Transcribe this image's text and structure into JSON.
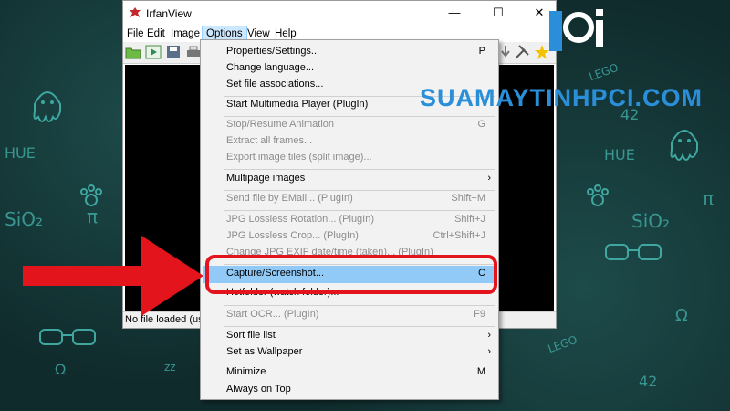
{
  "window": {
    "title": "IrfanView",
    "minimize_glyph": "—",
    "maximize_glyph": "☐",
    "close_glyph": "✕"
  },
  "menubar": {
    "items": [
      {
        "label": "File"
      },
      {
        "label": "Edit"
      },
      {
        "label": "Image"
      },
      {
        "label": "Options"
      },
      {
        "label": "View"
      },
      {
        "label": "Help"
      }
    ]
  },
  "status": {
    "text": "No file loaded (use"
  },
  "options_menu": {
    "items": [
      {
        "label": "Properties/Settings...",
        "shortcut": "P",
        "disabled": false
      },
      {
        "label": "Change language...",
        "shortcut": "",
        "disabled": false
      },
      {
        "label": "Set file associations...",
        "shortcut": "",
        "disabled": false
      },
      {
        "label": "Start Multimedia Player (PlugIn)",
        "shortcut": "",
        "disabled": false
      },
      {
        "label": "Stop/Resume Animation",
        "shortcut": "G",
        "disabled": true
      },
      {
        "label": "Extract all frames...",
        "shortcut": "",
        "disabled": true
      },
      {
        "label": "Export image tiles (split image)...",
        "shortcut": "",
        "disabled": true
      },
      {
        "label": "Multipage images",
        "shortcut": "",
        "disabled": false,
        "submenu": true
      },
      {
        "label": "Send file by EMail... (PlugIn)",
        "shortcut": "Shift+M",
        "disabled": true
      },
      {
        "label": "JPG Lossless Rotation... (PlugIn)",
        "shortcut": "Shift+J",
        "disabled": true
      },
      {
        "label": "JPG Lossless Crop... (PlugIn)",
        "shortcut": "Ctrl+Shift+J",
        "disabled": true
      },
      {
        "label": "Change JPG EXIF date/time (taken)... (PlugIn)",
        "shortcut": "",
        "disabled": true
      },
      {
        "label": "Capture/Screenshot...",
        "shortcut": "C",
        "disabled": false,
        "highlighted": true
      },
      {
        "label": "Hotfolder (watch folder)...",
        "shortcut": "",
        "disabled": false
      },
      {
        "label": "Start OCR... (PlugIn)",
        "shortcut": "F9",
        "disabled": true
      },
      {
        "label": "Sort file list",
        "shortcut": "",
        "disabled": false,
        "submenu": true
      },
      {
        "label": "Set as Wallpaper",
        "shortcut": "",
        "disabled": false,
        "submenu": true
      },
      {
        "label": "Minimize",
        "shortcut": "M",
        "disabled": false
      },
      {
        "label": "Always on Top",
        "shortcut": "",
        "disabled": false
      }
    ],
    "submenu_arrow": "›"
  },
  "watermark": {
    "text": "SUAMAYTINHPCI.COM",
    "logo_text": "pci"
  },
  "wallpaper": {
    "doodles": [
      "HUE",
      "SiO₂",
      "π",
      "Ω",
      "HUE",
      "SiO₂",
      "π",
      "Ω",
      "LEGO",
      "42",
      "LEGO",
      "42",
      "zz"
    ]
  },
  "colors": {
    "accent_highlight": "#91c9f7",
    "annotation_red": "#e3141b",
    "watermark_blue": "#2a8fd8",
    "wallpaper_bg": "#102b2c",
    "doodle": "#3fa6a0"
  }
}
